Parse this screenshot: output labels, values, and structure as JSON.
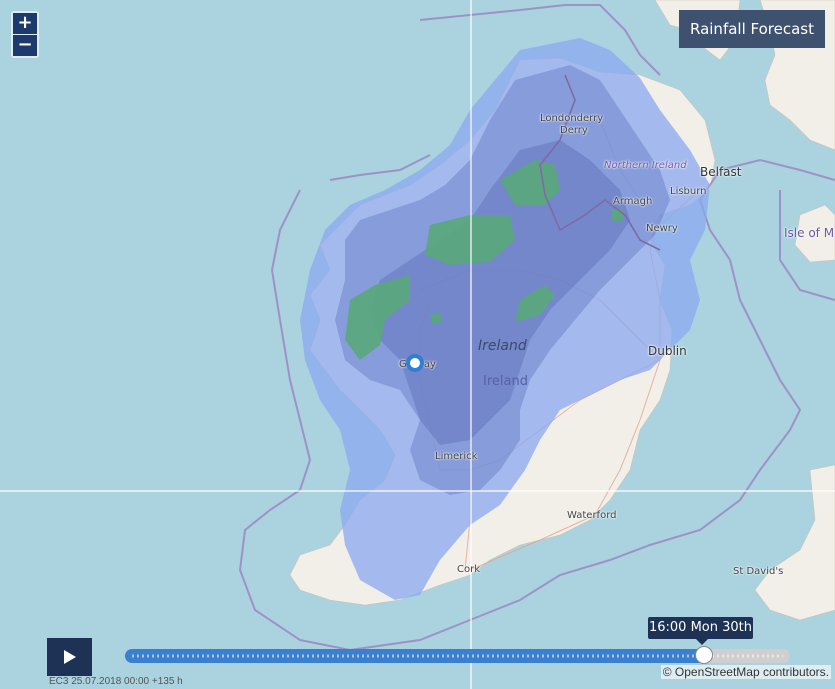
{
  "title_button": "Rainfall Forecast",
  "zoom": {
    "in_label": "+",
    "out_label": "−"
  },
  "timeline": {
    "time_label": "16:00 Mon 30th",
    "run_label": "EC3 25.07.2018 00:00 +135 h",
    "progress": 0.87
  },
  "attribution": "© OpenStreetMap contributors.",
  "places": {
    "londonderry": "Londonderry",
    "derry": "Derry",
    "northern_ireland": "Northern Ireland",
    "belfast": "Belfast",
    "lisburn": "Lisburn",
    "armagh": "Armagh",
    "newry": "Newry",
    "isle_of_man": "Isle of M",
    "ireland_italic": "Ireland",
    "ireland": "Ireland",
    "dublin": "Dublin",
    "galway": "Galway",
    "limerick": "Limerick",
    "waterford": "Waterford",
    "cork": "Cork",
    "st_davids": "St David's"
  },
  "colors": {
    "sea": "#aad3df",
    "land": "#f2efe9",
    "rain_light": "#8aa8f0",
    "rain_medium": "#6f84c9",
    "rain_heavy": "#5aa87a",
    "accent": "#1e3256"
  }
}
